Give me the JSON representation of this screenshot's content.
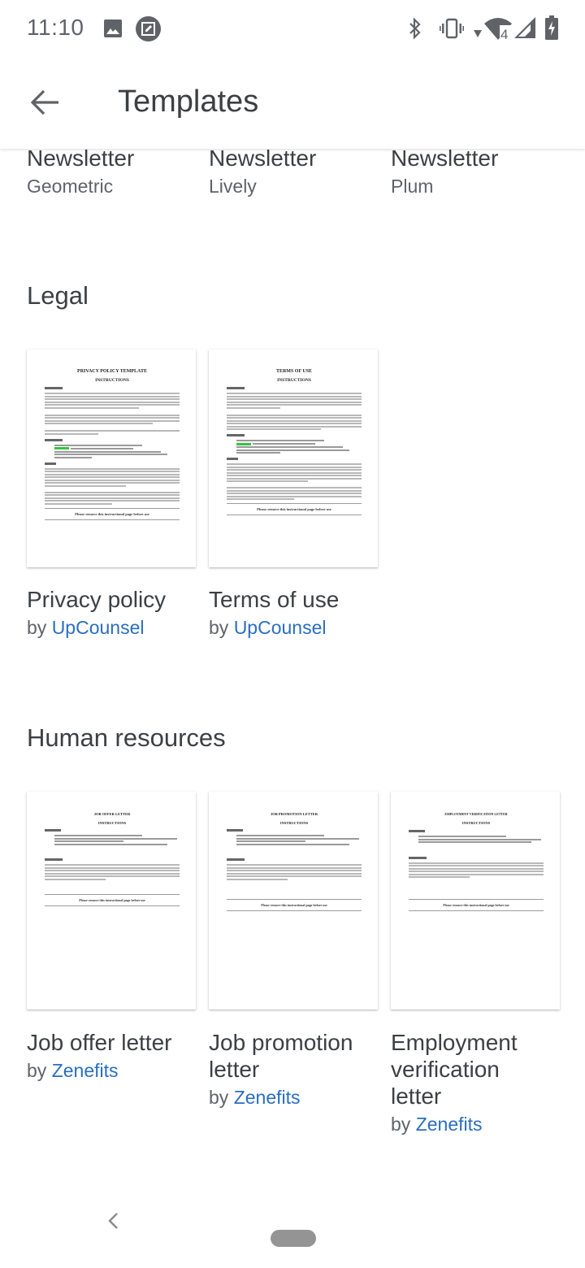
{
  "status_bar": {
    "time": "11:10",
    "left_icons": [
      "image-icon",
      "screenshot-edit-icon"
    ],
    "right_icons": [
      "bluetooth-icon",
      "vibrate-icon",
      "wifi-icon",
      "signal-icon",
      "battery-charging-icon"
    ],
    "wifi_badge": "4"
  },
  "app_bar": {
    "back_icon": "arrow-left-icon",
    "title": "Templates"
  },
  "newsletter_row": [
    {
      "title": "Newsletter",
      "subtitle": "Geometric"
    },
    {
      "title": "Newsletter",
      "subtitle": "Lively"
    },
    {
      "title": "Newsletter",
      "subtitle": "Plum"
    }
  ],
  "sections": [
    {
      "title": "Legal",
      "templates": [
        {
          "title": "Privacy policy",
          "by": "by",
          "author": "UpCounsel",
          "thumb": {
            "heading": "PRIVACY POLICY TEMPLATE",
            "subheading": "INSTRUCTIONS",
            "note": "Please remove this instructional page before use"
          }
        },
        {
          "title": "Terms of use",
          "by": "by",
          "author": "UpCounsel",
          "thumb": {
            "heading": "TERMS OF USE",
            "subheading": "INSTRUCTIONS",
            "note": "Please remove this instructional page before use"
          }
        }
      ]
    },
    {
      "title": "Human resources",
      "templates": [
        {
          "title": "Job offer letter",
          "by": "by",
          "author": "Zenefits",
          "thumb": {
            "heading": "JOB OFFER LETTER",
            "subheading": "INSTRUCTIONS",
            "note": "Please remove this instructional page before use"
          }
        },
        {
          "title": "Job promotion letter",
          "by": "by",
          "author": "Zenefits",
          "thumb": {
            "heading": "JOB PROMOTION LETTER",
            "subheading": "INSTRUCTIONS",
            "note": "Please remove this instructional page before use"
          }
        },
        {
          "title": "Employment verification letter",
          "by": "by",
          "author": "Zenefits",
          "thumb": {
            "heading": "EMPLOYMENT VERIFICATION LETTER",
            "subheading": "INSTRUCTIONS",
            "note": "Please remove this instructional page before use"
          }
        }
      ]
    }
  ],
  "colors": {
    "link": "#2a6ebf",
    "text_primary": "#3c4043",
    "text_secondary": "#5f6368",
    "highlight": "#34c53c"
  },
  "nav_bar": {
    "back_icon": "nav-back-chevron-icon",
    "home_icon": "home-pill-icon"
  }
}
